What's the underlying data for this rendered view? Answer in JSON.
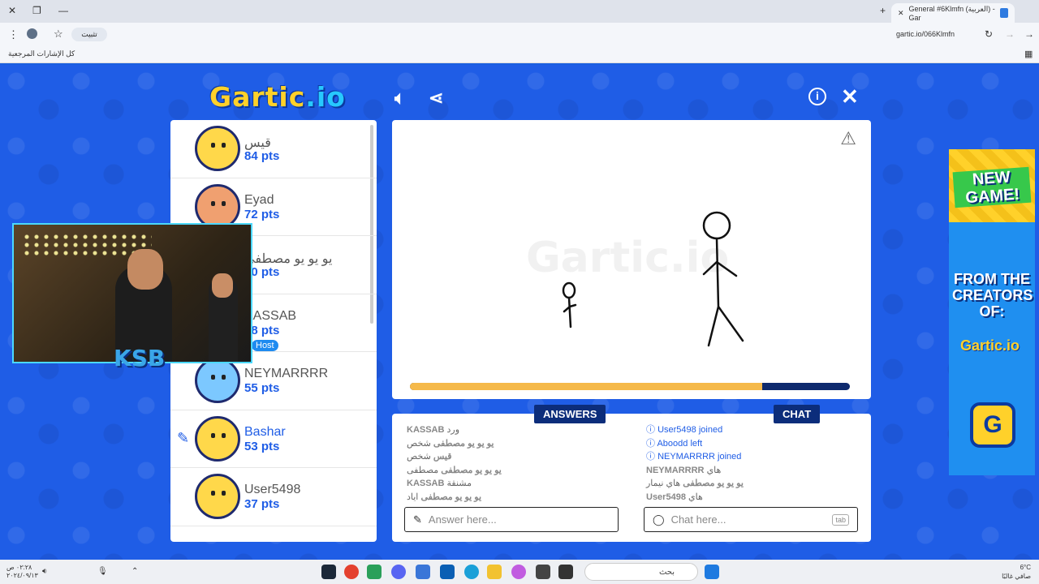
{
  "browser": {
    "tab_title": "General #6Klmfn (العربية) - Gar",
    "url": "gartic.io/066Klmfn",
    "install_label": "تثبيت",
    "bookmarks_label": "كل الإشارات المرجعية"
  },
  "game": {
    "logo_main": "Gartic",
    "logo_suffix": ".io",
    "players": [
      {
        "name": "قيس",
        "points": "84 pts",
        "drawing": false,
        "host": false
      },
      {
        "name": "Eyad",
        "points": "72 pts",
        "drawing": false,
        "host": false
      },
      {
        "name": "يو يو يو مصطفى",
        "points": "70 pts",
        "drawing": false,
        "host": false
      },
      {
        "name": "KASSAB",
        "points": "68 pts",
        "drawing": false,
        "host": true
      },
      {
        "name": "NEYMARRRR",
        "points": "55 pts",
        "drawing": false,
        "host": false
      },
      {
        "name": "Bashar",
        "points": "53 pts",
        "drawing": true,
        "host": false
      },
      {
        "name": "User5498",
        "points": "37 pts",
        "drawing": false,
        "host": false
      }
    ],
    "host_label": "Host",
    "canvas_watermark": "Gartic.io",
    "round_progress": 0.8,
    "answers_label": "ANSWERS",
    "chat_label": "CHAT",
    "answers": [
      {
        "user": "KASSAB",
        "text": "ورد"
      },
      {
        "user": "يو يو يو مصطفى",
        "text": "شخص"
      },
      {
        "user": "قيس",
        "text": "شخص"
      },
      {
        "user": "يو يو يو مصطفى",
        "text": "مصطفى"
      },
      {
        "user": "KASSAB",
        "text": "مشنقة"
      },
      {
        "user": "يو يو يو مصطفى",
        "text": "اياد"
      }
    ],
    "chat": [
      {
        "system": true,
        "user": "User5498",
        "text": "joined"
      },
      {
        "system": true,
        "user": "Aboodd",
        "text": "left"
      },
      {
        "system": true,
        "user": "NEYMARRRR",
        "text": "joined"
      },
      {
        "system": false,
        "user": "NEYMARRRR",
        "text": "هاي"
      },
      {
        "system": false,
        "user": "يو يو يو مصطفى",
        "text": "هاي نيمار"
      },
      {
        "system": false,
        "user": "User5498",
        "text": "هاي"
      }
    ],
    "answer_placeholder": "Answer here...",
    "chat_placeholder": "Chat here...",
    "tab_hint": "tab"
  },
  "ad": {
    "headline": "NEW GAME!",
    "subline": "FROM THE CREATORS OF:",
    "brand": "Gartic.io",
    "icon_letter": "G"
  },
  "webcam": {
    "overlay_logo": "KSB"
  },
  "taskbar": {
    "search_label": "بحث",
    "clock_time": "٠٢:٢٨ ص",
    "clock_date": "٢٠٢٤/٠٩/١٣",
    "weather_temp": "6°C",
    "weather_desc": "صافي غالبًا"
  }
}
